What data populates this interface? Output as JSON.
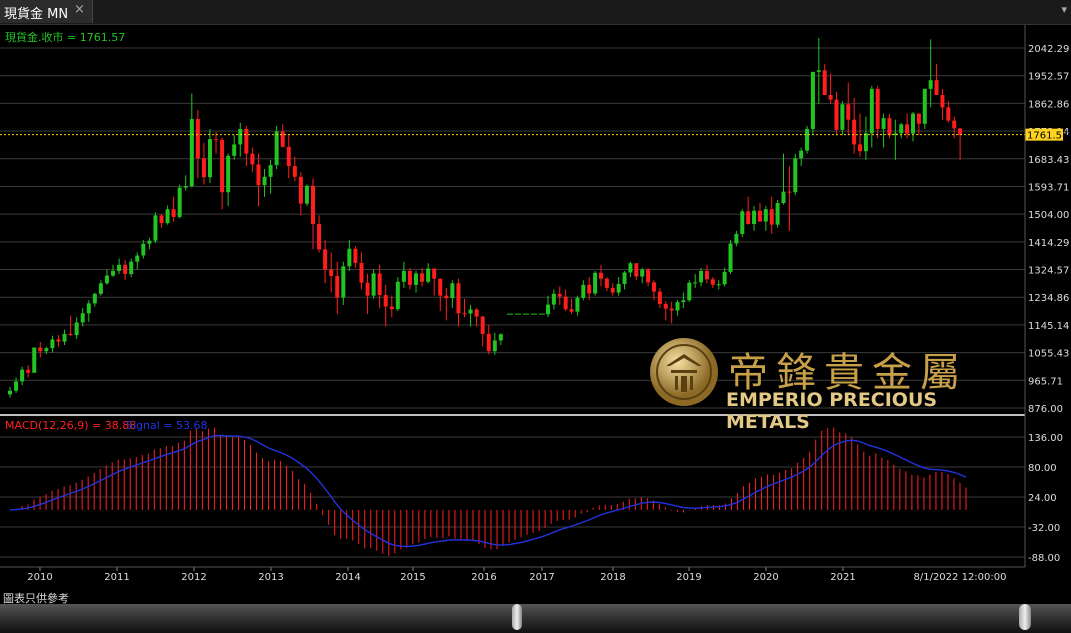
{
  "window": {
    "tab_title": "現貨金 MN",
    "close_glyph": "×",
    "menu_glyph": "▾"
  },
  "footer_note": "圖表只供參考",
  "watermark": {
    "chinese": "帝鋒貴金屬",
    "english": "EMPERIO PRECIOUS METALS"
  },
  "colors": {
    "up": "#22c322",
    "down": "#ff1e1e",
    "signal": "#2233dd",
    "macd": "#ff2020",
    "axis": "#dddddd",
    "lastprice": "#ffd21e"
  },
  "chart_data": {
    "type": "candlestick",
    "price_panel": {
      "label": "現貨金.收市 = 1761.57",
      "last_close": 1761.57,
      "y_ticks": [
        2042.29,
        1952.57,
        1862.86,
        1773.14,
        1683.43,
        1593.71,
        1504.0,
        1414.29,
        1324.57,
        1234.86,
        1145.14,
        1055.43,
        965.71,
        876.0
      ],
      "ylim": [
        876.0,
        2042.29
      ],
      "last_price_label": "1761.57",
      "candles": [
        [
          920,
          945,
          910,
          932
        ],
        [
          932,
          975,
          925,
          962
        ],
        [
          962,
          1010,
          950,
          1000
        ],
        [
          1000,
          1015,
          975,
          990
        ],
        [
          990,
          995,
          1050,
          1072
        ],
        [
          1072,
          1090,
          1040,
          1060
        ],
        [
          1060,
          1075,
          1050,
          1070
        ],
        [
          1070,
          1110,
          1055,
          1098
        ],
        [
          1098,
          1112,
          1075,
          1091
        ],
        [
          1091,
          1130,
          1080,
          1116
        ],
        [
          1116,
          1175,
          1110,
          1112
        ],
        [
          1112,
          1170,
          1100,
          1153
        ],
        [
          1153,
          1200,
          1140,
          1183
        ],
        [
          1183,
          1225,
          1155,
          1215
        ],
        [
          1215,
          1250,
          1205,
          1246
        ],
        [
          1246,
          1290,
          1240,
          1280
        ],
        [
          1280,
          1325,
          1275,
          1305
        ],
        [
          1305,
          1340,
          1300,
          1320
        ],
        [
          1320,
          1360,
          1310,
          1340
        ],
        [
          1340,
          1355,
          1290,
          1310
        ],
        [
          1310,
          1360,
          1300,
          1350
        ],
        [
          1350,
          1380,
          1325,
          1370
        ],
        [
          1370,
          1420,
          1360,
          1408
        ],
        [
          1408,
          1428,
          1390,
          1418
        ],
        [
          1418,
          1510,
          1410,
          1500
        ],
        [
          1500,
          1505,
          1460,
          1475
        ],
        [
          1475,
          1532,
          1470,
          1520
        ],
        [
          1520,
          1560,
          1480,
          1495
        ],
        [
          1495,
          1600,
          1490,
          1590
        ],
        [
          1590,
          1630,
          1580,
          1595
        ],
        [
          1595,
          1895,
          1590,
          1812
        ],
        [
          1812,
          1842,
          1620,
          1685
        ],
        [
          1685,
          1735,
          1600,
          1624
        ],
        [
          1624,
          1780,
          1605,
          1747
        ],
        [
          1747,
          1770,
          1700,
          1745
        ],
        [
          1745,
          1752,
          1520,
          1575
        ],
        [
          1575,
          1700,
          1530,
          1693
        ],
        [
          1693,
          1760,
          1680,
          1730
        ],
        [
          1730,
          1800,
          1690,
          1780
        ],
        [
          1780,
          1790,
          1660,
          1700
        ],
        [
          1700,
          1720,
          1640,
          1665
        ],
        [
          1665,
          1700,
          1530,
          1598
        ],
        [
          1598,
          1650,
          1560,
          1625
        ],
        [
          1625,
          1680,
          1570,
          1663
        ],
        [
          1663,
          1790,
          1650,
          1772
        ],
        [
          1772,
          1795,
          1720,
          1722
        ],
        [
          1722,
          1760,
          1620,
          1660
        ],
        [
          1660,
          1690,
          1610,
          1625
        ],
        [
          1625,
          1640,
          1500,
          1538
        ],
        [
          1538,
          1600,
          1530,
          1596
        ],
        [
          1596,
          1620,
          1390,
          1472
        ],
        [
          1472,
          1500,
          1380,
          1390
        ],
        [
          1390,
          1420,
          1280,
          1324
        ],
        [
          1324,
          1380,
          1250,
          1304
        ],
        [
          1304,
          1350,
          1180,
          1234
        ],
        [
          1234,
          1350,
          1210,
          1335
        ],
        [
          1335,
          1420,
          1320,
          1392
        ],
        [
          1392,
          1400,
          1330,
          1346
        ],
        [
          1346,
          1380,
          1260,
          1282
        ],
        [
          1282,
          1310,
          1180,
          1240
        ],
        [
          1240,
          1325,
          1230,
          1312
        ],
        [
          1312,
          1340,
          1200,
          1242
        ],
        [
          1242,
          1275,
          1140,
          1205
        ],
        [
          1205,
          1240,
          1170,
          1196
        ],
        [
          1196,
          1300,
          1190,
          1285
        ],
        [
          1285,
          1350,
          1265,
          1320
        ],
        [
          1320,
          1330,
          1260,
          1275
        ],
        [
          1275,
          1320,
          1250,
          1312
        ],
        [
          1312,
          1330,
          1270,
          1285
        ],
        [
          1285,
          1345,
          1280,
          1328
        ],
        [
          1328,
          1320,
          1240,
          1295
        ],
        [
          1295,
          1290,
          1190,
          1240
        ],
        [
          1240,
          1265,
          1160,
          1232
        ],
        [
          1232,
          1290,
          1200,
          1280
        ],
        [
          1280,
          1295,
          1140,
          1183
        ],
        [
          1183,
          1230,
          1170,
          1182
        ],
        [
          1182,
          1210,
          1140,
          1195
        ],
        [
          1195,
          1200,
          1140,
          1172
        ],
        [
          1172,
          1175,
          1075,
          1116
        ],
        [
          1116,
          1145,
          1050,
          1060
        ],
        [
          1060,
          1120,
          1048,
          1095
        ],
        [
          1095,
          1118,
          1080,
          1115
        ]
      ],
      "gap_line": {
        "value": 1180
      },
      "candles_2": [
        [
          1180,
          1240,
          1170,
          1211
        ],
        [
          1211,
          1260,
          1195,
          1246
        ],
        [
          1246,
          1270,
          1210,
          1237
        ],
        [
          1237,
          1260,
          1190,
          1196
        ],
        [
          1196,
          1230,
          1180,
          1188
        ],
        [
          1188,
          1240,
          1175,
          1233
        ],
        [
          1233,
          1290,
          1225,
          1275
        ],
        [
          1275,
          1300,
          1225,
          1247
        ],
        [
          1247,
          1320,
          1240,
          1314
        ],
        [
          1314,
          1340,
          1270,
          1295
        ],
        [
          1295,
          1300,
          1255,
          1265
        ],
        [
          1265,
          1280,
          1240,
          1250
        ],
        [
          1250,
          1300,
          1240,
          1278
        ],
        [
          1278,
          1320,
          1260,
          1315
        ],
        [
          1315,
          1350,
          1300,
          1345
        ],
        [
          1345,
          1330,
          1290,
          1302
        ],
        [
          1302,
          1330,
          1280,
          1325
        ],
        [
          1325,
          1330,
          1270,
          1283
        ],
        [
          1283,
          1290,
          1225,
          1253
        ],
        [
          1253,
          1265,
          1200,
          1213
        ],
        [
          1213,
          1222,
          1160,
          1198
        ],
        [
          1198,
          1220,
          1150,
          1192
        ],
        [
          1192,
          1225,
          1175,
          1219
        ],
        [
          1219,
          1250,
          1200,
          1225
        ],
        [
          1225,
          1290,
          1220,
          1282
        ],
        [
          1282,
          1310,
          1265,
          1283
        ],
        [
          1283,
          1330,
          1270,
          1320
        ],
        [
          1320,
          1340,
          1280,
          1293
        ],
        [
          1293,
          1300,
          1265,
          1275
        ],
        [
          1275,
          1290,
          1260,
          1277
        ],
        [
          1277,
          1330,
          1270,
          1317
        ],
        [
          1317,
          1420,
          1310,
          1409
        ],
        [
          1409,
          1450,
          1400,
          1440
        ],
        [
          1440,
          1520,
          1430,
          1513
        ],
        [
          1513,
          1560,
          1470,
          1472
        ],
        [
          1472,
          1530,
          1450,
          1515
        ],
        [
          1515,
          1540,
          1480,
          1480
        ],
        [
          1480,
          1530,
          1450,
          1520
        ],
        [
          1520,
          1560,
          1440,
          1470
        ],
        [
          1470,
          1550,
          1460,
          1540
        ],
        [
          1540,
          1700,
          1535,
          1577
        ],
        [
          1577,
          1660,
          1450,
          1575
        ],
        [
          1575,
          1700,
          1565,
          1685
        ],
        [
          1685,
          1720,
          1660,
          1710
        ],
        [
          1710,
          1790,
          1700,
          1780
        ],
        [
          1780,
          1960,
          1760,
          1965
        ],
        [
          1965,
          2075,
          1860,
          1970
        ],
        [
          1970,
          1990,
          1890,
          1890
        ],
        [
          1890,
          1960,
          1860,
          1875
        ],
        [
          1875,
          1900,
          1760,
          1777
        ],
        [
          1777,
          1870,
          1760,
          1860
        ],
        [
          1860,
          1930,
          1760,
          1810
        ],
        [
          1810,
          1880,
          1700,
          1730
        ],
        [
          1730,
          1830,
          1690,
          1708
        ],
        [
          1708,
          1820,
          1680,
          1766
        ],
        [
          1766,
          1920,
          1720,
          1910
        ],
        [
          1910,
          1920,
          1750,
          1780
        ],
        [
          1780,
          1830,
          1720,
          1815
        ],
        [
          1815,
          1830,
          1750,
          1760
        ],
        [
          1760,
          1810,
          1680,
          1766
        ],
        [
          1766,
          1800,
          1750,
          1795
        ],
        [
          1795,
          1830,
          1750,
          1765
        ],
        [
          1765,
          1835,
          1740,
          1830
        ],
        [
          1830,
          1800,
          1760,
          1797
        ],
        [
          1797,
          1900,
          1780,
          1910
        ],
        [
          1910,
          2070,
          1850,
          1938
        ],
        [
          1938,
          1990,
          1900,
          1890
        ],
        [
          1890,
          1910,
          1810,
          1850
        ],
        [
          1850,
          1870,
          1800,
          1807
        ],
        [
          1807,
          1820,
          1750,
          1782
        ],
        [
          1782,
          1780,
          1680,
          1761
        ]
      ]
    },
    "macd_panel": {
      "label": "MACD(12,26,9) = 38.88",
      "signal_label": "Signal = 53.68",
      "macd_value": 38.88,
      "signal_value": 53.68,
      "y_ticks": [
        136.0,
        80.0,
        24.0,
        -32.0,
        -88.0
      ],
      "ylim": [
        -88,
        136
      ]
    },
    "x_ticks": [
      "2010",
      "2011",
      "2012",
      "2013",
      "2014",
      "2015",
      "2016",
      "2017",
      "2018",
      "2019",
      "2020",
      "2021"
    ],
    "x_end_label": "8/1/2022 12:00:00"
  }
}
